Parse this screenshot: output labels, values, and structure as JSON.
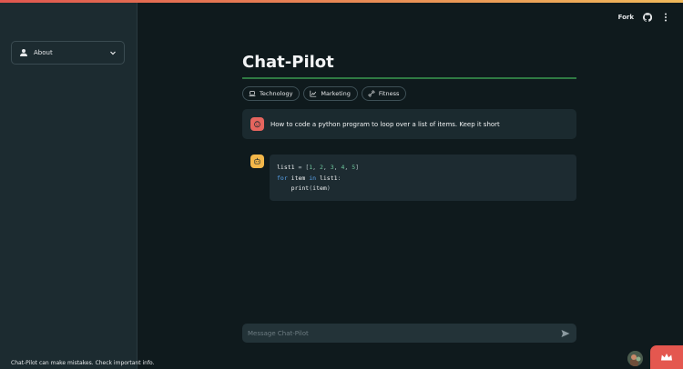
{
  "colors": {
    "accent": "#e0574f",
    "rule": "#2f7a43",
    "user_avatar": "#e5655e",
    "bot_avatar": "#f3b74a"
  },
  "sidebar": {
    "about_label": "About",
    "about_icon": "user-icon",
    "footer_text": "Chat-Pilot can make mistakes. Check important info."
  },
  "header": {
    "fork_label": "Fork",
    "github_icon": "github-icon",
    "menu_icon": "kebab-menu-icon"
  },
  "main": {
    "title": "Chat-Pilot",
    "pills": [
      {
        "label": "Technology",
        "icon": "laptop-icon"
      },
      {
        "label": "Marketing",
        "icon": "chart-icon"
      },
      {
        "label": "Fitness",
        "icon": "dumbbell-icon"
      }
    ],
    "user_message": "How to code a python program to loop over a list of items. Keep it short",
    "bot_code": [
      "list1 = [1, 2, 3, 4, 5]",
      "for item in list1:",
      "    print(item)"
    ]
  },
  "input": {
    "placeholder": "Message Chat-Pilot",
    "value": ""
  }
}
